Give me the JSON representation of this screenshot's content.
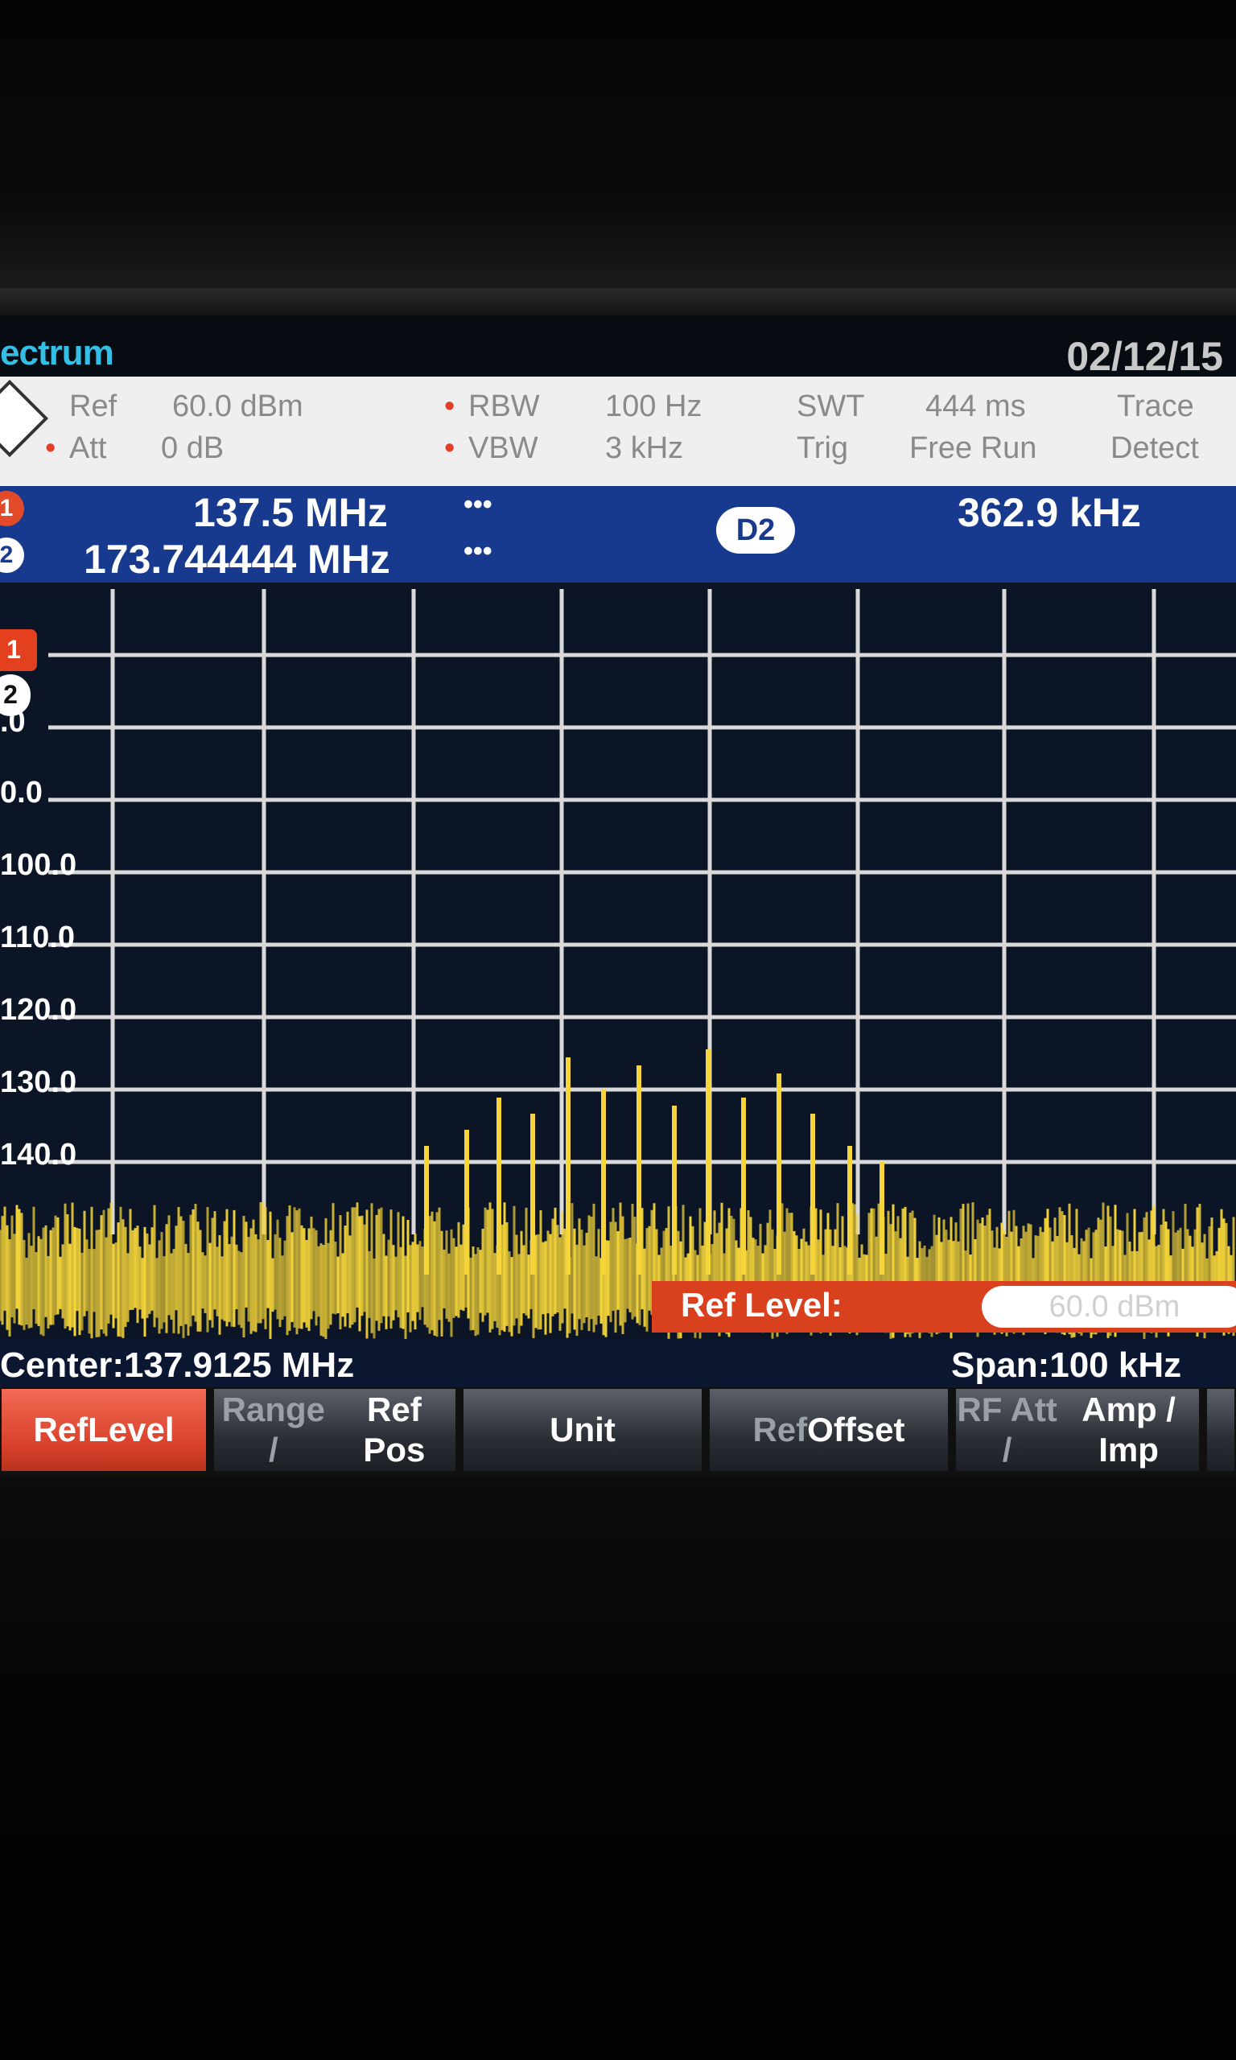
{
  "window": {
    "title": "ectrum",
    "date": "02/12/15"
  },
  "settings": {
    "ref_label": "Ref",
    "ref_value": "60.0 dBm",
    "att_label": "Att",
    "att_value": "0 dB",
    "rbw_label": "RBW",
    "rbw_value": "100 Hz",
    "vbw_label": "VBW",
    "vbw_value": "3 kHz",
    "swt_label": "SWT",
    "swt_value": "444 ms",
    "trg_label": "Trig",
    "trg_value": "Free Run",
    "trace_label": "Trace",
    "detect_label": "Detect"
  },
  "markers": {
    "m1_index": "1",
    "m1_freq": "137.5 MHz",
    "m1_level": "•••",
    "m2_index": "2",
    "m2_freq": "173.744444 MHz",
    "m2_level": "•••",
    "delta_label": "D2",
    "delta_value": "362.9 kHz"
  },
  "plot": {
    "trace_badge": "1",
    "marker_badge": "2",
    "y_tick_labels": [
      ".0",
      "0.0",
      "100.0",
      "110.0",
      "120.0",
      "130.0",
      "140.0"
    ],
    "grid_color": "#d9d9d9",
    "trace_color": "#f5d53a"
  },
  "ref_popup": {
    "label": "Ref Level:",
    "value": "60.0 dBm"
  },
  "status": {
    "center": "Center:137.9125 MHz",
    "span": "Span:100 kHz"
  },
  "softkeys": [
    {
      "line1": "Ref",
      "line2": "Level"
    },
    {
      "line1": "Range /",
      "line2": "Ref Pos"
    },
    {
      "line1": "Unit",
      "line2": ""
    },
    {
      "line1": "Ref",
      "line2": "Offset"
    },
    {
      "line1": "RF Att /",
      "line2": "Amp / Imp"
    }
  ]
}
